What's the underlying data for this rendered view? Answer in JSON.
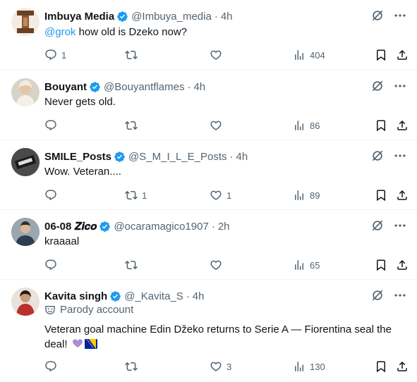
{
  "posts": [
    {
      "name": "Imbuya Media",
      "handle": "@Imbuya_media",
      "dot": "·",
      "time": "4h",
      "mention": "@grok",
      "text": " how old is Dzeko now?",
      "replies": "1",
      "reposts": "",
      "likes": "",
      "views": "404",
      "avatar_color": "#7a4a2b"
    },
    {
      "name": "Bouyant",
      "handle": "@Bouyantflames",
      "dot": "·",
      "time": "4h",
      "text": "Never gets old.",
      "replies": "",
      "reposts": "",
      "likes": "",
      "views": "86",
      "avatar_color": "#c9c2b2"
    },
    {
      "name": "SMILE_Posts",
      "handle": "@S_M_I_L_E_Posts",
      "dot": "·",
      "time": "4h",
      "text": "Wow. Veteran....",
      "replies": "",
      "reposts": "1",
      "likes": "1",
      "views": "89",
      "avatar_color": "#3a3a3a"
    },
    {
      "name": "06-08 𝒁𝒊𝒄𝒐",
      "handle": "@ocaramagico1907",
      "dot": "·",
      "time": "2h",
      "text": "kraaaal",
      "replies": "",
      "reposts": "",
      "likes": "",
      "views": "65",
      "avatar_color": "#5a6b7a"
    },
    {
      "name": "Kavita singh",
      "handle": "@_Kavita_S",
      "dot": "·",
      "time": "4h",
      "parody_label": "Parody account",
      "text": "Veteran goal machine Edin Džeko returns to Serie A — Fiorentina seal the deal!",
      "replies": "",
      "reposts": "",
      "likes": "3",
      "views": "130",
      "avatar_color": "#b8322f"
    }
  ],
  "colors": {
    "verified": "#1d9bf0",
    "muted": "#536471",
    "link": "#1d9bf0"
  },
  "icons": [
    "reply-icon",
    "repost-icon",
    "like-icon",
    "views-icon",
    "bookmark-icon",
    "share-icon",
    "grok-icon",
    "more-icon",
    "verified-badge-icon",
    "parody-mask-icon"
  ]
}
